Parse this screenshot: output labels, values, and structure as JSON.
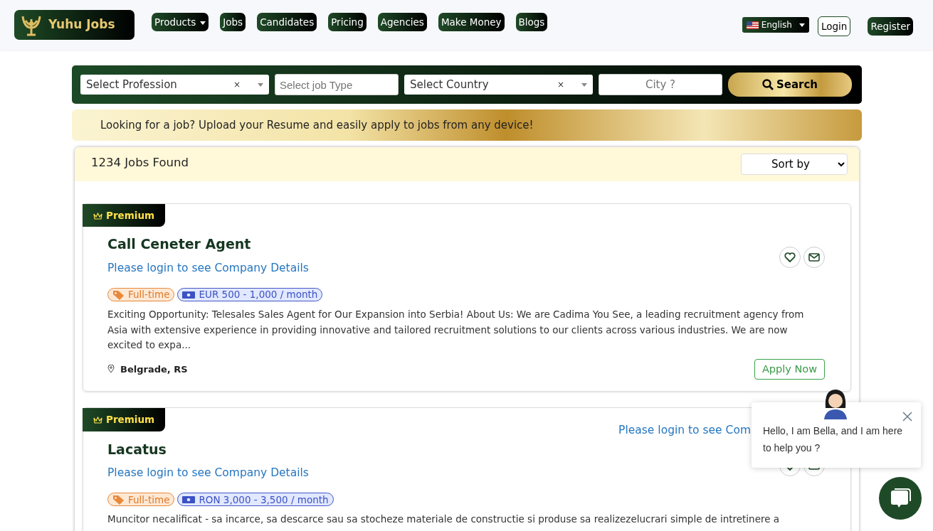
{
  "navbar": {
    "logo": "Yuhu Jobs",
    "menu": [
      {
        "label": "Products",
        "dropdown": true
      },
      {
        "label": "Jobs",
        "dropdown": false
      },
      {
        "label": "Candidates",
        "dropdown": false
      },
      {
        "label": "Pricing",
        "dropdown": false
      },
      {
        "label": "Agencies",
        "dropdown": false
      },
      {
        "label": "Make Money",
        "dropdown": false
      },
      {
        "label": "Blogs",
        "dropdown": false
      }
    ],
    "language": "English",
    "login": "Login",
    "register": "Register"
  },
  "search": {
    "profession": "Select Profession",
    "profession_clear": "×",
    "job_type": {
      "placeholder": "Select job Type"
    },
    "country": "Select Country",
    "country_clear": "×",
    "city": {
      "placeholder": "City ?"
    },
    "button": "Search"
  },
  "banner": "Looking for a job? Upload your Resume and easily apply to jobs from any device!",
  "results": {
    "count": "1234 Jobs Found",
    "sort": "Sort by"
  },
  "jobs": [
    {
      "badge": "Premium",
      "title": "Call Ceneter Agent",
      "company": "Please login to see Company Details",
      "tags": [
        {
          "kind": "type",
          "text": "Full-time"
        },
        {
          "kind": "salary",
          "text": "EUR 500  -  1,000 / month"
        }
      ],
      "description": "Exciting Opportunity: Telesales Sales Agent for Our Expansion into Serbia! About Us: We are Cadima You See, a leading recruitment agency from Asia with extensive experience in providing innovative and tailored recruitment solutions to our clients across various industries. We are now excited to expa...",
      "location": "Belgrade, RS",
      "apply": "Apply Now"
    },
    {
      "badge": "Premium",
      "company_top": "Please login to see Com",
      "title": "Lacatus",
      "company": "Please login to see Company Details",
      "tags": [
        {
          "kind": "type",
          "text": "Full-time"
        },
        {
          "kind": "salary",
          "text": "RON 3,000  -  3,500 / month"
        }
      ],
      "description": "Muncitor necalificat - sa incarce, sa descarce sau sa stocheze materiale de constructie si produse sa realizezelucrari simple de intretinere a"
    }
  ],
  "chat": {
    "message": "Hello, I am Bella, and I am here to help you ?"
  }
}
